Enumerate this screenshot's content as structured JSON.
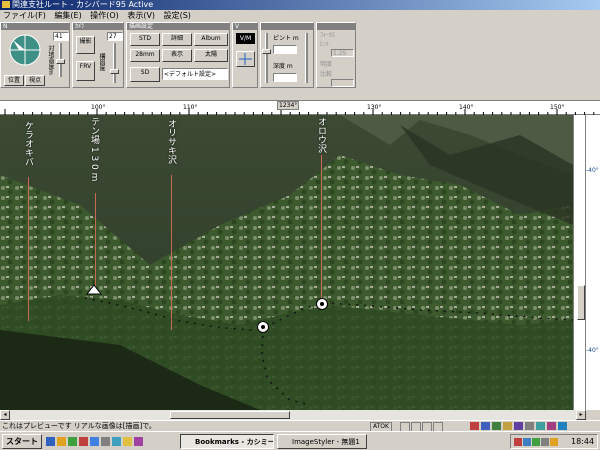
{
  "window": {
    "title": "関連支社ルート - カシバード95  Active"
  },
  "menu": [
    "ファイル(F)",
    "編集(E)",
    "操作(O)",
    "表示(V)",
    "設定(S)"
  ],
  "panels": {
    "view": {
      "buttons": [
        "位置",
        "視点"
      ],
      "readout": "41"
    },
    "camera": {
      "head": "ｶﾒﾗ",
      "buttons": [
        "撮影",
        "FRV"
      ],
      "readout": "27"
    },
    "render": {
      "head": "描画設定",
      "buttons": [
        "STD",
        "詳細",
        "Album",
        "28mm",
        "表示",
        "太陽",
        "SD",
        "<デフォルト設定>"
      ]
    },
    "vm": {
      "label": "V/M"
    },
    "distance": {
      "label1": "ピント m",
      "label2": "深度 m"
    },
    "focus": {
      "label1": "ﾌｫｰｶｽ",
      "label2": "ﾋﾝﾄ",
      "label3": "明度",
      "label4": "比較",
      "value": "1.25"
    }
  },
  "ruler": {
    "ticks": [
      "100°",
      "110°",
      "120°",
      "130°",
      "140°",
      "150°"
    ],
    "current": "1234°"
  },
  "labels3d": [
    "ケラオキバ",
    "テン場 1 3 0 m",
    "オリサキ沢",
    "オロウ沢"
  ],
  "rightscale": {
    "ticks": [
      "-40°",
      "-40°"
    ]
  },
  "status": {
    "text": "これはプレビューです リアルな画像は[描画]で。",
    "mode": "ATOK"
  },
  "taskbar": {
    "start": "スタート",
    "tasks": [
      "Bookmarks - カシミー…",
      "ImageStyler - 無題1"
    ],
    "clock": "18:44"
  }
}
